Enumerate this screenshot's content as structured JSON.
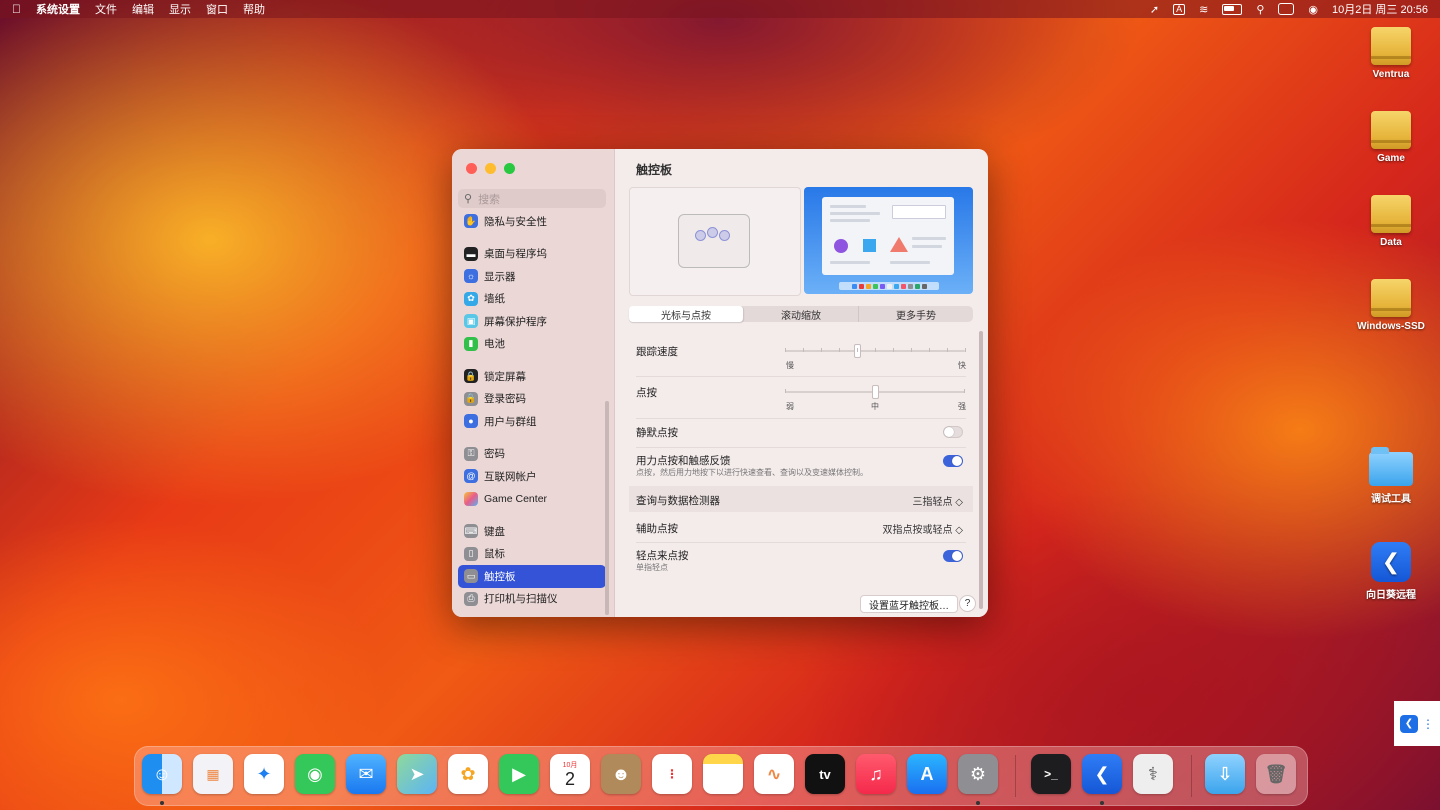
{
  "menubar": {
    "apple": "",
    "app": "系统设置",
    "menus": [
      "文件",
      "编辑",
      "显示",
      "窗口",
      "帮助"
    ],
    "input_indicator": "A",
    "datetime": "10月2日 周三  20:56"
  },
  "desktop": {
    "icons": [
      "Ventrua",
      "Game",
      "Data",
      "Windows-SSD",
      "调试工具",
      "向日葵远程"
    ]
  },
  "sidebar": {
    "search_placeholder": "搜索",
    "items": [
      {
        "label": "隐私与安全性",
        "icon": "hand-icon",
        "color": "#3d6fe0"
      },
      {
        "label": "桌面与程序坞",
        "icon": "dock-icon",
        "color": "#222222"
      },
      {
        "label": "显示器",
        "icon": "sun-icon",
        "color": "#3d6fe0"
      },
      {
        "label": "墙纸",
        "icon": "flower-icon",
        "color": "#35a8e8"
      },
      {
        "label": "屏幕保护程序",
        "icon": "screensaver-icon",
        "color": "#5bc7e6"
      },
      {
        "label": "电池",
        "icon": "battery-icon",
        "color": "#33c04a"
      },
      {
        "label": "锁定屏幕",
        "icon": "lock-icon",
        "color": "#222222"
      },
      {
        "label": "登录密码",
        "icon": "lock-icon",
        "color": "#8e8e93"
      },
      {
        "label": "用户与群组",
        "icon": "users-icon",
        "color": "#3d6fe0"
      },
      {
        "label": "密码",
        "icon": "key-icon",
        "color": "#8e8e93"
      },
      {
        "label": "互联网帐户",
        "icon": "at-icon",
        "color": "#3d6fe0"
      },
      {
        "label": "Game Center",
        "icon": "game-center-icon",
        "color": "#e85d8a"
      },
      {
        "label": "键盘",
        "icon": "keyboard-icon",
        "color": "#8e8e93"
      },
      {
        "label": "鼠标",
        "icon": "mouse-icon",
        "color": "#8e8e93"
      },
      {
        "label": "触控板",
        "icon": "trackpad-icon",
        "color": "#8e8e93"
      },
      {
        "label": "打印机与扫描仪",
        "icon": "printer-icon",
        "color": "#8e8e93"
      }
    ],
    "selected": "触控板"
  },
  "main": {
    "title": "触控板",
    "tabs": [
      "光标与点按",
      "滚动缩放",
      "更多手势"
    ],
    "active_tab": "光标与点按",
    "tracking": {
      "label": "跟踪速度",
      "min_label": "慢",
      "max_label": "快",
      "level": 0.4
    },
    "click": {
      "label": "点按",
      "min_label": "弱",
      "mid_label": "中",
      "max_label": "强",
      "level": 0.5
    },
    "silent_click": {
      "label": "静默点按",
      "on": false
    },
    "force_click": {
      "label": "用力点按和触感反馈",
      "desc": "点按，然后用力地按下以进行快速查看、查询以及变速媒体控制。",
      "on": true
    },
    "lookup": {
      "label": "查询与数据检测器",
      "value": "三指轻点 ◇"
    },
    "secondary_click": {
      "label": "辅助点按",
      "value": "双指点按或轻点 ◇"
    },
    "tap_to_click": {
      "label": "轻点来点按",
      "desc": "单指轻点",
      "on": true
    },
    "bt_button": "设置蓝牙触控板…",
    "help_button": "?"
  },
  "dock": {
    "calendar_month": "10月",
    "calendar_day": "2"
  },
  "colors": {
    "accent": "#3553d6",
    "switch_on": "#3c63d9"
  }
}
